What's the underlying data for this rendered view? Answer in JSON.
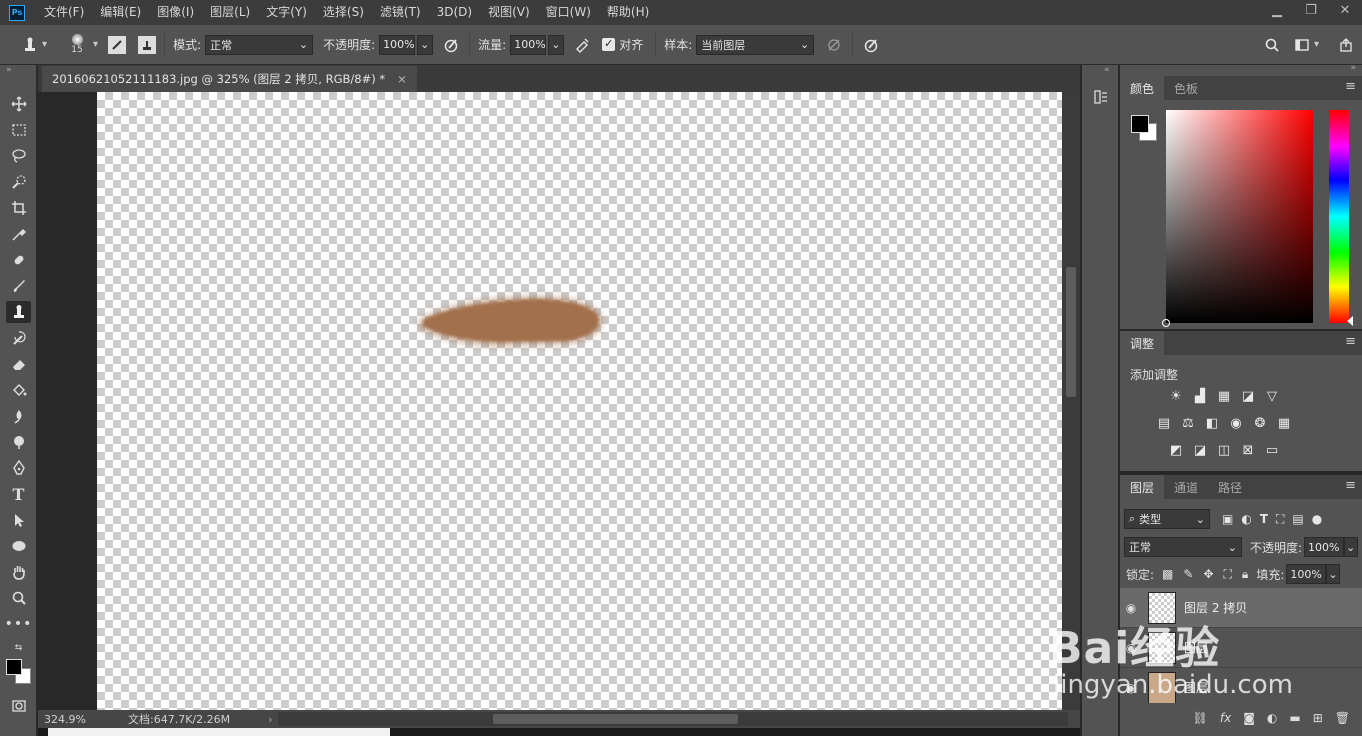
{
  "app": {
    "logo": "Ps"
  },
  "menu": [
    "文件(F)",
    "编辑(E)",
    "图像(I)",
    "图层(L)",
    "文字(Y)",
    "选择(S)",
    "滤镜(T)",
    "3D(D)",
    "视图(V)",
    "窗口(W)",
    "帮助(H)"
  ],
  "window_buttons": {
    "minimize": "▁",
    "restore": "❐",
    "close": "✕"
  },
  "options": {
    "brush_size": "15",
    "mode_label": "模式:",
    "mode_value": "正常",
    "opacity_label": "不透明度:",
    "opacity_value": "100%",
    "flow_label": "流量:",
    "flow_value": "100%",
    "align_label": "对齐",
    "sample_label": "样本:",
    "sample_value": "当前图层"
  },
  "document": {
    "tab_title": "20160621052111183.jpg @ 325% (图层 2 拷贝, RGB/8#) *",
    "close": "×",
    "zoom": "324.9%",
    "doc_info": "文档:647.7K/2.26M"
  },
  "stroke_color": "#a26f4c",
  "panels": {
    "color": {
      "tabs": [
        "颜色",
        "色板"
      ],
      "fg": "#000000",
      "bg": "#ffffff"
    },
    "adjustments": {
      "tab": "调整",
      "title": "添加调整"
    },
    "layers": {
      "tabs": [
        "图层",
        "通道",
        "路径"
      ],
      "filter_kind": "类型",
      "blend_mode": "正常",
      "opacity_label": "不透明度:",
      "opacity_value": "100%",
      "lock_label": "锁定:",
      "fill_label": "填充:",
      "fill_value": "100%",
      "items": [
        {
          "name": "图层 2 拷贝",
          "selected": true
        },
        {
          "name": "图层",
          "selected": false
        },
        {
          "name": "图层",
          "selected": false
        }
      ]
    }
  },
  "watermark": {
    "main": "Bai经验",
    "sub": "jingyan.baidu.com"
  }
}
